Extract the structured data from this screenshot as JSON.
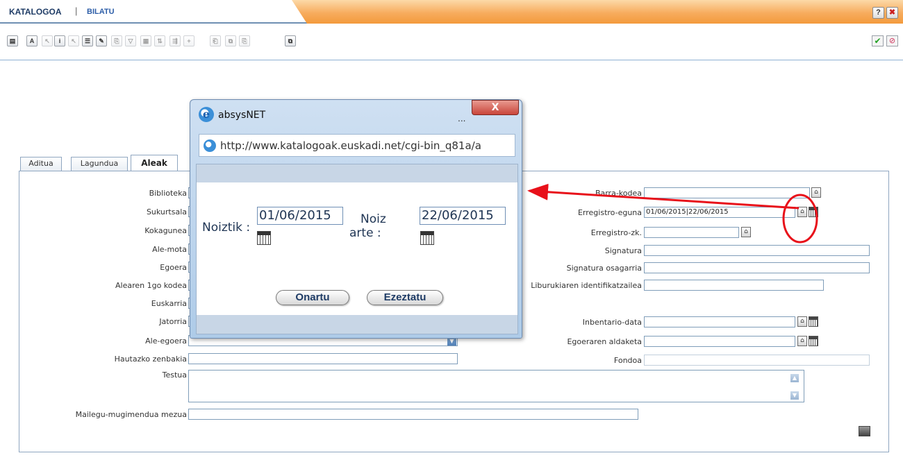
{
  "header": {
    "title": "KATALOGOA",
    "separator": "|",
    "link": "BILATU",
    "help_label": "?",
    "close_label": "✖"
  },
  "toolbar": {
    "icons": [
      "list-menu-icon",
      "text-icon",
      "info-icon",
      "record-icon",
      "edit-icon",
      "sort-icon",
      "copy-icon"
    ],
    "ok_label": "✔",
    "cancel_label": "⊘"
  },
  "tabs": [
    "Aditua",
    "Lagundua",
    "Aleak"
  ],
  "form_left": {
    "biblioteka": "Biblioteka",
    "sukurtsala": "Sukurtsala",
    "kokagunea": "Kokagunea",
    "ale_mota": "Ale-mota",
    "egoera": "Egoera",
    "alearen_kodea": "Alearen 1go kodea",
    "euskarria": "Euskarria",
    "jatorria": "Jatorria",
    "ale_egoera": "Ale-egoera",
    "hautazko_zenbakia": "Hautazko zenbakia",
    "testua": "Testua",
    "mailegu_mezua": "Mailegu-mugimendua mezua"
  },
  "form_right": {
    "barra_kodea": "Barra-kodea",
    "erregistro_eguna": "Erregistro-eguna",
    "erregistro_eguna_value": "01/06/2015|22/06/2015",
    "erregistro_zk": "Erregistro-zk.",
    "signatura": "Signatura",
    "signatura_osagarria": "Signatura osagarria",
    "liburukiaren_id": "Liburukiaren identifikatzailea",
    "inbentario_data": "Inbentario-data",
    "egoeraren_aldaketa": "Egoeraren aldaketa",
    "fondoa": "Fondoa"
  },
  "popup": {
    "title": "absysNET",
    "ellipsis": "...",
    "close_label": "X",
    "url": "http://www.katalogoak.euskadi.net/cgi-bin_q81a/a",
    "from_label": "Noiztik :",
    "from_value": "01/06/2015",
    "to_label_line1": "Noiz",
    "to_label_line2": "arte :",
    "to_value": "22/06/2015",
    "accept_button": "Onartu",
    "cancel_button": "Ezeztatu"
  },
  "colors": {
    "accent_blue": "#1f3c66",
    "header_orange": "#f39a3c",
    "annotation_red": "#e8111a"
  }
}
